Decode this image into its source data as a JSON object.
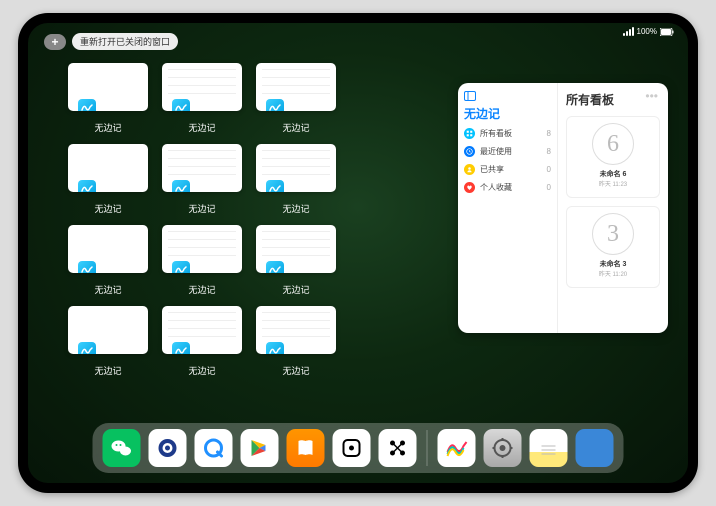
{
  "status": {
    "carrier": "••••",
    "wifi": "wifi",
    "battery": "100%"
  },
  "top": {
    "plus": "+",
    "reopen_label": "重新打开已关闭的窗口"
  },
  "app_name": "无边记",
  "tiles": [
    {
      "label": "无边记",
      "style": "blank"
    },
    {
      "label": "无边记",
      "style": "detailed"
    },
    {
      "label": "无边记",
      "style": "detailed"
    },
    {
      "label": "无边记",
      "style": "blank"
    },
    {
      "label": "无边记",
      "style": "detailed"
    },
    {
      "label": "无边记",
      "style": "detailed"
    },
    {
      "label": "无边记",
      "style": "blank"
    },
    {
      "label": "无边记",
      "style": "detailed"
    },
    {
      "label": "无边记",
      "style": "detailed"
    },
    {
      "label": "无边记",
      "style": "blank"
    },
    {
      "label": "无边记",
      "style": "detailed"
    },
    {
      "label": "无边记",
      "style": "detailed"
    }
  ],
  "panel": {
    "title": "无边记",
    "rows": [
      {
        "icon": "grid",
        "label": "所有看板",
        "count": "8",
        "color": "#00c2ff"
      },
      {
        "icon": "clock",
        "label": "最近使用",
        "count": "8",
        "color": "#007aff"
      },
      {
        "icon": "people",
        "label": "已共享",
        "count": "0",
        "color": "#ffcc00"
      },
      {
        "icon": "heart",
        "label": "个人收藏",
        "count": "0",
        "color": "#ff3b30"
      }
    ],
    "right_title": "所有看板",
    "boards": [
      {
        "sketch": "6",
        "name": "未命名 6",
        "sub": "昨天 11:23"
      },
      {
        "sketch": "3",
        "name": "未命名 3",
        "sub": "昨天 11:20"
      }
    ]
  },
  "dock": [
    {
      "name": "wechat"
    },
    {
      "name": "qqbrowser"
    },
    {
      "name": "quark"
    },
    {
      "name": "play"
    },
    {
      "name": "books"
    },
    {
      "name": "dice"
    },
    {
      "name": "connect"
    },
    {
      "name": "freeform"
    },
    {
      "name": "settings"
    },
    {
      "name": "notes"
    },
    {
      "name": "folder"
    }
  ]
}
